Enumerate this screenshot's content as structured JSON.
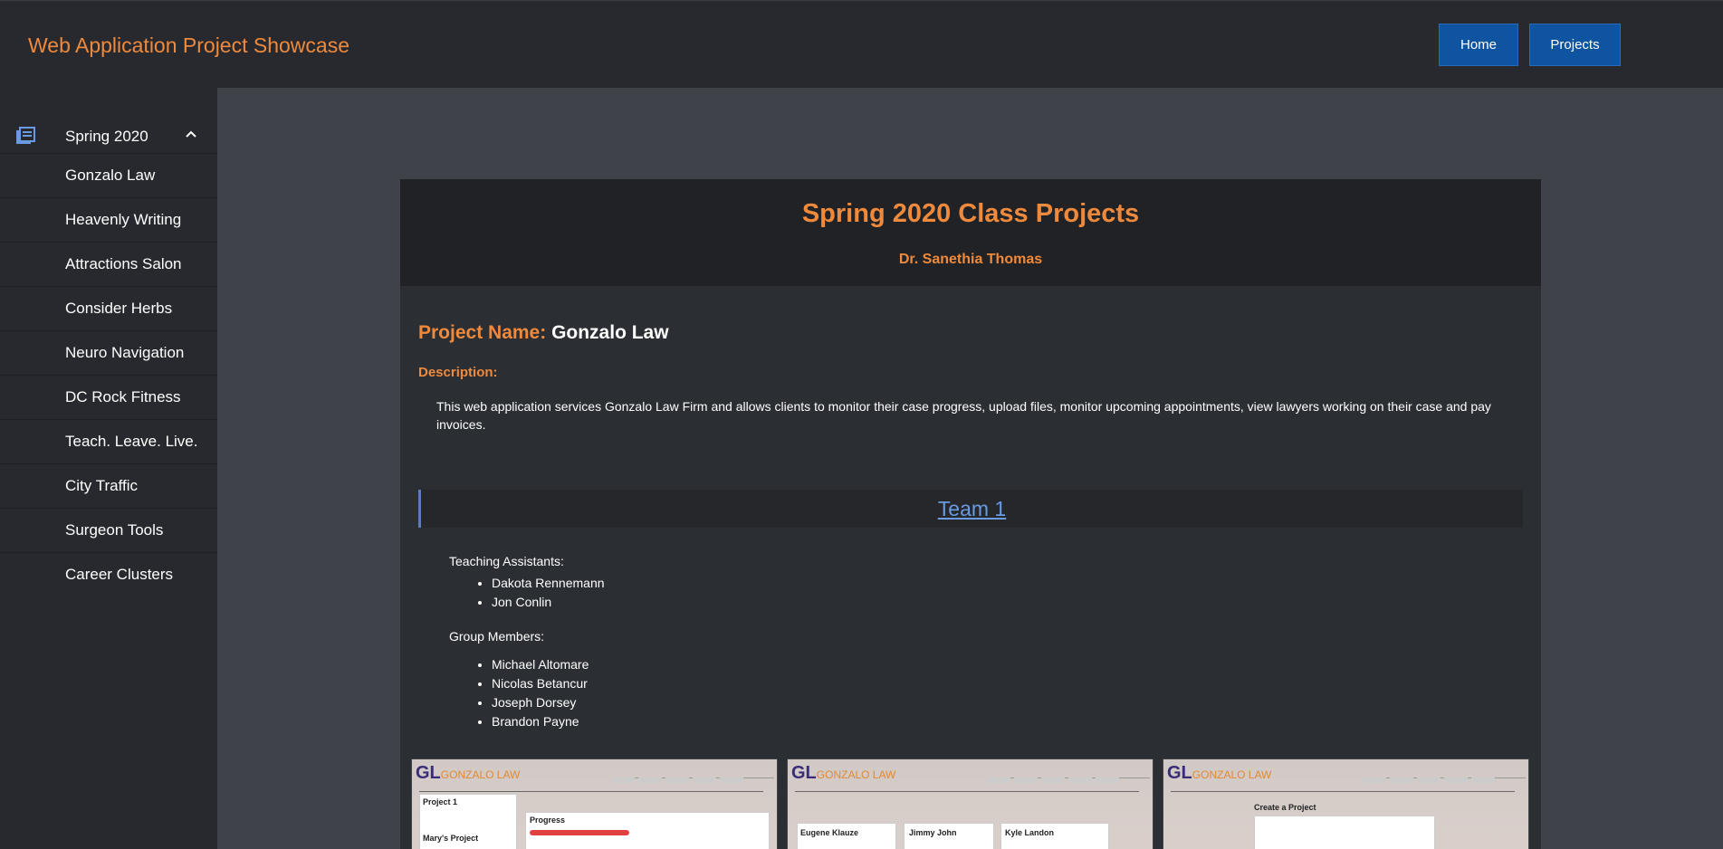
{
  "header": {
    "brand": "Web Application Project Showcase",
    "nav": {
      "home": "Home",
      "projects": "Projects"
    }
  },
  "sidebar": {
    "section": {
      "label": "Spring 2020",
      "icon": "book-icon",
      "toggle_icon": "chevron-up-icon"
    },
    "items": [
      {
        "label": "Gonzalo Law"
      },
      {
        "label": "Heavenly Writing"
      },
      {
        "label": "Attractions Salon"
      },
      {
        "label": "Consider Herbs"
      },
      {
        "label": "Neuro Navigation"
      },
      {
        "label": "DC Rock Fitness"
      },
      {
        "label": "Teach. Leave. Live."
      },
      {
        "label": "City Traffic"
      },
      {
        "label": "Surgeon Tools"
      },
      {
        "label": "Career Clusters"
      }
    ]
  },
  "card": {
    "title": "Spring 2020 Class Projects",
    "instructor": "Dr. Sanethia Thomas"
  },
  "project": {
    "name_label": "Project Name:",
    "name": "Gonzalo Law",
    "description_label": "Description:",
    "description": "This web application services Gonzalo Law Firm and allows clients to monitor their case progress, upload files, monitor upcoming appointments, view lawyers working on their case and pay invoices."
  },
  "team": {
    "title": "Team 1",
    "ta_label": "Teaching Assistants:",
    "tas": [
      "Dakota Rennemann",
      "Jon Conlin"
    ],
    "members_label": "Group Members:",
    "members": [
      "Michael Altomare",
      "Nicolas Betancur",
      "Joseph Dorsey",
      "Brandon Payne"
    ]
  },
  "screenshots": [
    {
      "logo": "GL",
      "logo_sub": "GONZALO LAW",
      "texts": [
        "Project 1",
        "Mary's Project",
        "Progress"
      ]
    },
    {
      "logo": "GL",
      "logo_sub": "GONZALO LAW",
      "texts": [
        "Eugene Klauze",
        "Jimmy John",
        "Kyle Landon"
      ]
    },
    {
      "logo": "GL",
      "logo_sub": "GONZALO LAW",
      "texts": [
        "Create a Project"
      ]
    }
  ],
  "colors": {
    "accent": "#ef8a3c",
    "nav_button": "#0e54a0",
    "link": "#6a9be0"
  }
}
